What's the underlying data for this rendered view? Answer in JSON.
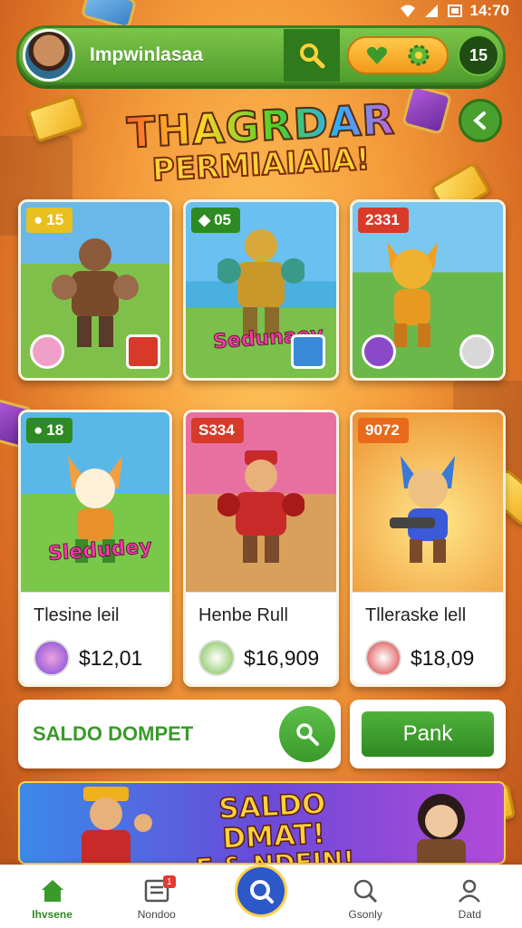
{
  "status_bar": {
    "time": "14:70"
  },
  "header": {
    "username": "Impwinlasaa",
    "level": "15",
    "icons": [
      "search-icon",
      "heart-icon",
      "gear-icon"
    ]
  },
  "title": {
    "line1": "THAGRDAR",
    "line2": "PERMIAIAIA!"
  },
  "cards": [
    {
      "tag": "15",
      "bg": "#4a9ad8",
      "tag_color": "#e8c020",
      "label": ""
    },
    {
      "tag": "05",
      "bg": "#3aa0d8",
      "tag_color": "#2e8a22",
      "label": "Sedunaey"
    },
    {
      "tag": "2331",
      "bg": "#5ab04a",
      "tag_color": "#d83a2a",
      "label": ""
    },
    {
      "tag": "18",
      "bg": "#4ab04a",
      "tag_color": "#2e8a22",
      "label": "Sledudey"
    }
  ],
  "tiles": [
    {
      "tag": "S334",
      "tag_color": "#d83a2a",
      "name": "Henbe Rull",
      "price": "$16,909"
    },
    {
      "tag": "9072",
      "tag_color": "#e86a1a",
      "name": "Tlleraske lell",
      "price": "$18,09"
    }
  ],
  "first_tile": {
    "name": "Tlesine leil",
    "price": "$12,01"
  },
  "wallet": {
    "label": "SALDO DOMPET"
  },
  "rank": {
    "label": "Pank"
  },
  "banner": {
    "line1": "SALDO DMAT!",
    "line2": "F & NDEIN!"
  },
  "nav": [
    {
      "label": "Ihvsene",
      "active": true
    },
    {
      "label": "Nondoo",
      "badge": "1"
    },
    {
      "label": ""
    },
    {
      "label": "Gsonly"
    },
    {
      "label": "Datd"
    }
  ]
}
